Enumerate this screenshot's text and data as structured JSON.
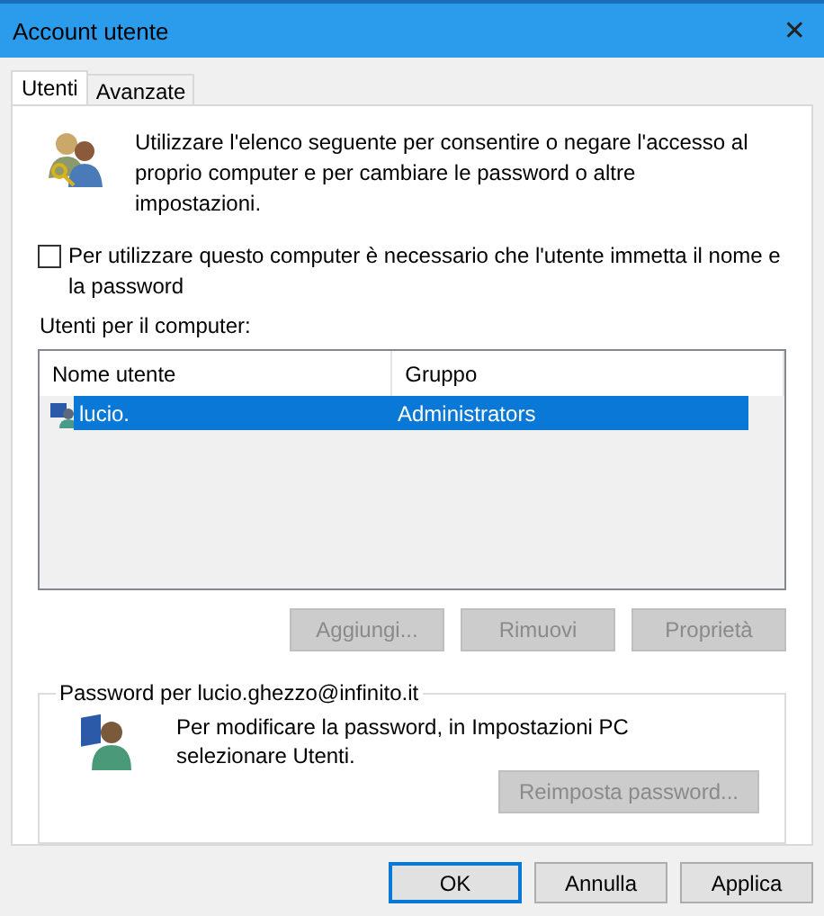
{
  "window": {
    "title": "Account utente",
    "close": "✕"
  },
  "tabs": [
    {
      "label": "Utenti",
      "selected": true
    },
    {
      "label": "Avanzate",
      "selected": false
    }
  ],
  "intro": "Utilizzare l'elenco seguente per consentire o negare l'accesso al proprio computer e per cambiare le password o altre impostazioni.",
  "require_login": {
    "label": "Per utilizzare questo computer è necessario che l'utente immetta il nome e la password",
    "checked": false
  },
  "users_label": "Utenti per il computer:",
  "table": {
    "columns": [
      "Nome utente",
      "Gruppo"
    ],
    "rows": [
      {
        "name": "lucio.",
        "group": "Administrators",
        "selected": true
      }
    ]
  },
  "user_buttons": [
    {
      "label": "Aggiungi...",
      "disabled": true
    },
    {
      "label": "Rimuovi",
      "disabled": true
    },
    {
      "label": "Proprietà",
      "disabled": true
    }
  ],
  "password_group": {
    "title": "Password per lucio.ghezzo@infinito.it",
    "text": "Per modificare la password, in Impostazioni PC selezionare Utenti.",
    "button": {
      "label": "Reimposta password...",
      "disabled": true
    }
  },
  "dialog_buttons": [
    {
      "label": "OK",
      "default": true
    },
    {
      "label": "Annulla",
      "default": false
    },
    {
      "label": "Applica",
      "default": false
    }
  ]
}
